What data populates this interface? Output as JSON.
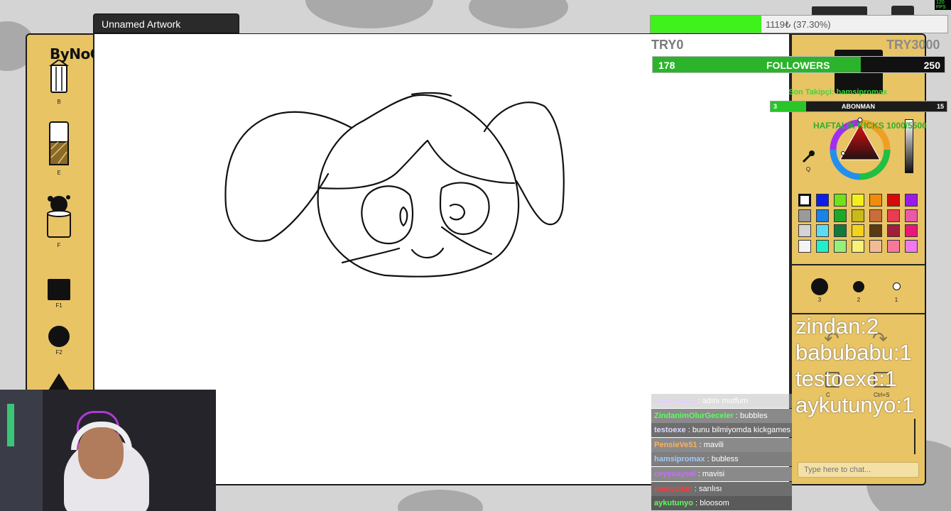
{
  "window": {
    "title": "Unnamed Artwork"
  },
  "logo": {
    "text_main": "ByNoGam",
    "text_accent": "e"
  },
  "tools": [
    {
      "name": "pencil",
      "key": "B"
    },
    {
      "name": "eraser",
      "key": "E"
    },
    {
      "name": "fill-bucket",
      "key": "F"
    },
    {
      "name": "square-brush",
      "key": "F1"
    },
    {
      "name": "round-brush",
      "key": "F2"
    }
  ],
  "right_panel": {
    "eyedropper_key": "Q",
    "palette": [
      "#ffffff",
      "#0d1ee8",
      "#70e21c",
      "#f4ee1a",
      "#f08c0c",
      "#d60a0a",
      "#9a1ae8",
      "#9a9a9a",
      "#1a82e8",
      "#1ea828",
      "#c8ba1a",
      "#c86e3c",
      "#e83c50",
      "#e85aa8",
      "#d4d4d4",
      "#5cdcf0",
      "#127a3c",
      "#f4d21a",
      "#5a3a12",
      "#a01e3c",
      "#e8187a",
      "#f4f4f4",
      "#20f0c8",
      "#96f078",
      "#f8f078",
      "#f0bc96",
      "#f8789a",
      "#f07aec"
    ],
    "brush_sizes": [
      {
        "key": "3"
      },
      {
        "key": "2"
      },
      {
        "key": "1"
      }
    ],
    "action_keys": [
      "C",
      "Ctrl+S"
    ]
  },
  "overlay": {
    "progress_text": "1119₺ (37.30%)",
    "progress_fraction": 0.373,
    "try_left": "TRY0",
    "try_right": "TRY3000",
    "followers": {
      "current": "178",
      "label": "FOLLOWERS",
      "goal": "250",
      "fraction": 0.712
    },
    "sub_line": "Son Takipçi: hamsipromax",
    "abonman": {
      "current": "3",
      "label": "ABONMAN",
      "goal": "15",
      "fraction": 0.2
    },
    "haftalik": "HAFTALIK KICKS 1000/5500",
    "leaderboard": [
      "zindan:2",
      "babubabu:1",
      "testoexe:1",
      "aykutunyo:1"
    ]
  },
  "chat": {
    "placeholder": "Type here to chat...",
    "messages": [
      {
        "user": "sudevmazz",
        "text": "adını mutfum",
        "user_color": "#c8a0ff",
        "bg": "#bdbdbd"
      },
      {
        "user": "ZindanimOlurGeceler",
        "text": "bubbles",
        "user_color": "#5cff5c",
        "bg": "#8a8a8a"
      },
      {
        "user": "testoexe",
        "text": "bunu bilmiyomda kickgames yaz",
        "user_color": "#d8d8ff",
        "bg": "#6e6e6e"
      },
      {
        "user": "PensieVe51",
        "text": "mavili",
        "user_color": "#ffb05c",
        "bg": "#8a8a8a"
      },
      {
        "user": "hamsipromax",
        "text": "bubless",
        "user_color": "#a0c8ff",
        "bg": "#7e7e7e"
      },
      {
        "user": "ceyyoaysel",
        "text": "mavisi",
        "user_color": "#c86cff",
        "bg": "#8a8a8a"
      },
      {
        "user": "umaycikm",
        "text": "sarılısı",
        "user_color": "#ff3c3c",
        "bg": "#6e6e6e"
      },
      {
        "user": "aykutunyo",
        "text": "bloosom",
        "user_color": "#5cff5c",
        "bg": "#5a5a5a"
      }
    ]
  },
  "fps": "120 FPS"
}
